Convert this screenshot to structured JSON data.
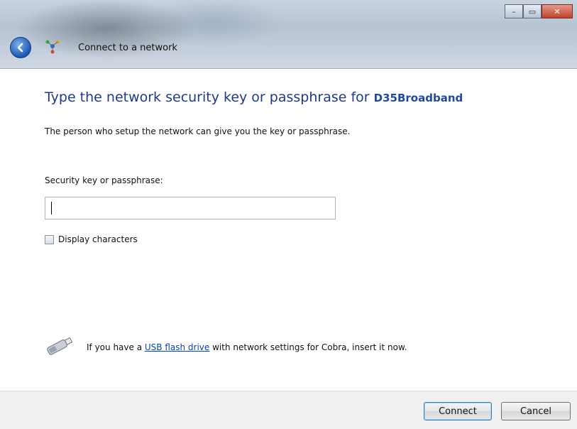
{
  "window": {
    "title": "Connect to a network",
    "controls": {
      "minimize_icon": "minimize-icon",
      "maximize_icon": "maximize-icon",
      "close_icon": "close-icon"
    }
  },
  "content": {
    "heading_prefix": "Type the network security key or passphrase for ",
    "network_name": "D35Broadband",
    "description": "The person who setup the network can give you the key or passphrase.",
    "key_label": "Security key or passphrase:",
    "key_value": "",
    "display_characters_label": "Display characters",
    "display_characters_checked": false,
    "usb_prefix": "If you have a ",
    "usb_link": "USB flash drive",
    "usb_suffix": " with network settings for Cobra, insert it now."
  },
  "buttons": {
    "connect": "Connect",
    "cancel": "Cancel"
  },
  "colors": {
    "heading": "#1e3a8a",
    "link": "#0645ad",
    "accent_blue": "#1d57b2"
  }
}
